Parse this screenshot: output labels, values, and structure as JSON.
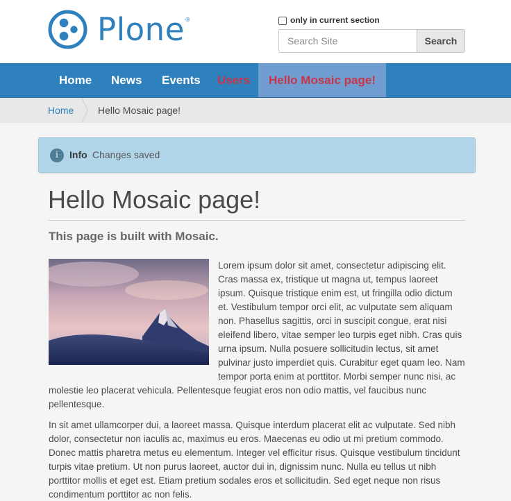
{
  "header": {
    "logo_text": "Plone",
    "logo_registered": "®",
    "search": {
      "section_label": "only in current section",
      "placeholder": "Search Site",
      "button_label": "Search"
    }
  },
  "nav": {
    "items": [
      {
        "label": "Home"
      },
      {
        "label": "News"
      },
      {
        "label": "Events"
      },
      {
        "label": "Users"
      },
      {
        "label": "Hello Mosaic page!"
      }
    ]
  },
  "breadcrumb": {
    "home": "Home",
    "current": "Hello Mosaic page!"
  },
  "alert": {
    "icon": "i",
    "title": "Info",
    "message": "Changes saved"
  },
  "page": {
    "title": "Hello Mosaic page!",
    "description": "This page is built with Mosaic.",
    "paragraph_1": "Lorem ipsum dolor sit amet, consectetur adipiscing elit. Cras massa ex, tristique ut magna ut, tempus laoreet ipsum. Quisque tristique enim est, ut fringilla odio dictum et. Vestibulum tempor orci elit, ac vulputate sem aliquam non. Phasellus sagittis, orci in suscipit congue, erat nisi eleifend libero, vitae semper leo turpis eget nibh. Cras quis urna ipsum. Nulla posuere sollicitudin lectus, sit amet pulvinar justo imperdiet quis. Curabitur eget quam leo. Nam tempor porta enim at porttitor. Morbi semper nunc nisi, ac molestie leo placerat vehicula. Pellentesque feugiat eros non odio mattis, vel faucibus nunc pellentesque.",
    "paragraph_2": "In sit amet ullamcorper dui, a laoreet massa. Quisque interdum placerat elit ac vulputate. Sed nibh dolor, consectetur non iaculis ac, maximus eu eros. Maecenas eu odio ut mi pretium commodo. Donec mattis pharetra metus eu elementum. Integer vel efficitur risus. Quisque vestibulum tincidunt turpis vitae pretium. Ut non purus laoreet, auctor dui in, dignissim nunc. Nulla eu tellus ut nibh porttitor mollis et eget est. Etiam pretium sodales eros et sollicitudin. Sed eget neque non risus condimentum porttitor ac non felis."
  },
  "colors": {
    "brand": "#2e81bc",
    "nav_active_bg": "#6f9dd0",
    "nav_highlight_text": "#c8354b",
    "alert_bg": "#b0d4e8"
  }
}
